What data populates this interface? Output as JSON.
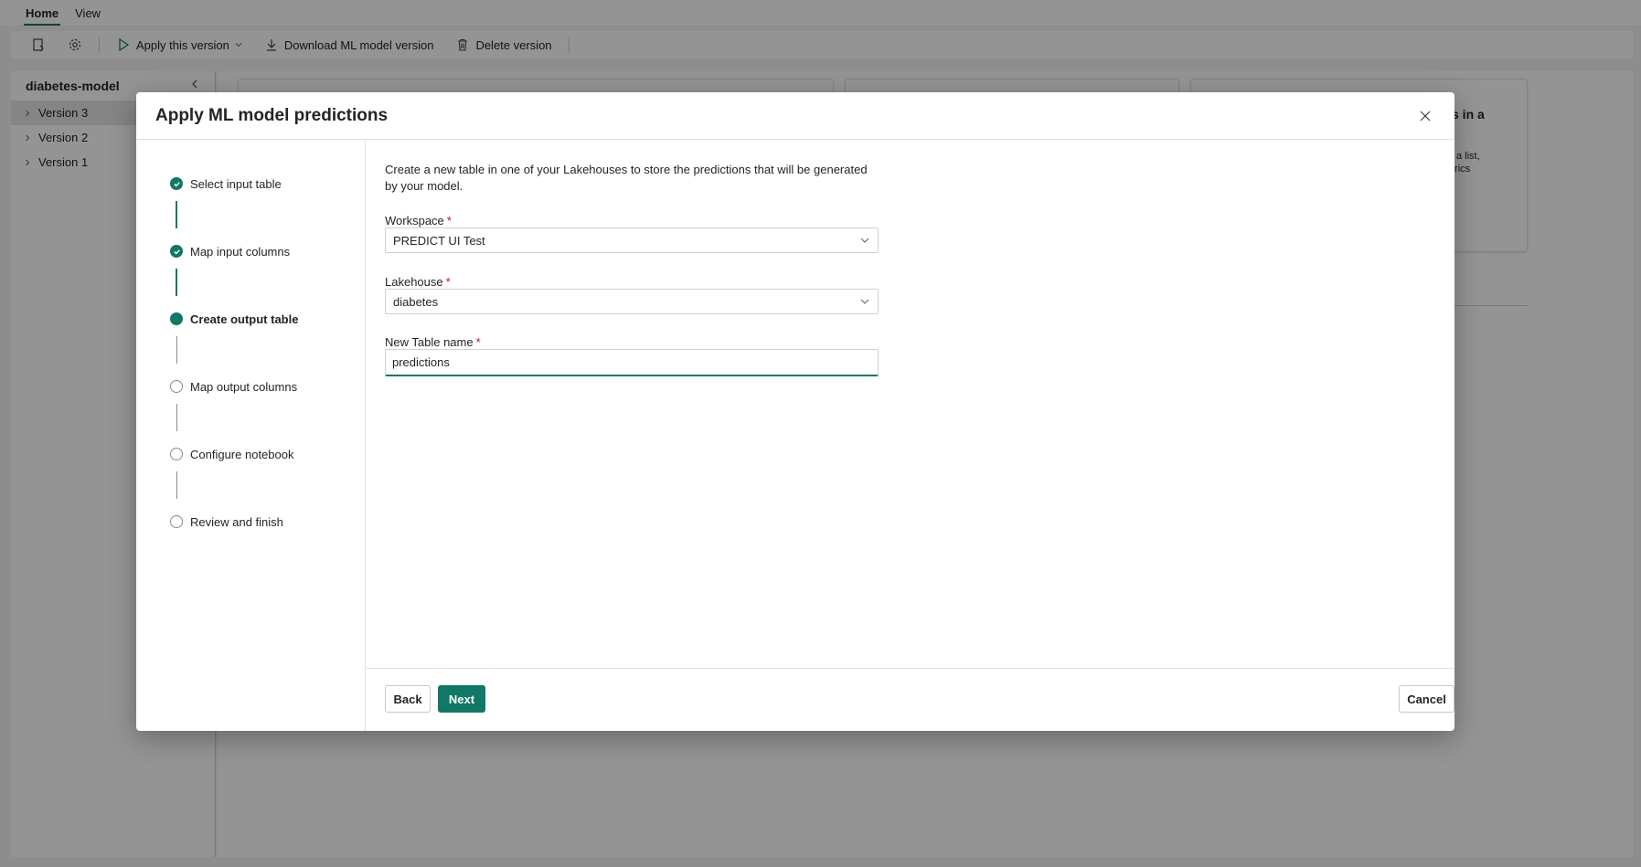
{
  "app": {
    "tabs": [
      {
        "label": "Home",
        "active": true
      },
      {
        "label": "View",
        "active": false
      }
    ],
    "toolbar": {
      "apply_label": "Apply this version",
      "download_label": "Download ML model version",
      "delete_label": "Delete version"
    },
    "sidebar": {
      "title": "diabetes-model",
      "items": [
        {
          "label": "Version 3"
        },
        {
          "label": "Version 2"
        },
        {
          "label": "Version 1"
        }
      ]
    },
    "card_fragments": {
      "title_fragment": "s in a",
      "line1": "a list,",
      "line2": "trics"
    }
  },
  "dialog": {
    "title": "Apply ML model predictions",
    "steps": [
      {
        "label": "Select input table",
        "status": "done"
      },
      {
        "label": "Map input columns",
        "status": "done"
      },
      {
        "label": "Create output table",
        "status": "current"
      },
      {
        "label": "Map output columns",
        "status": "todo"
      },
      {
        "label": "Configure notebook",
        "status": "todo"
      },
      {
        "label": "Review and finish",
        "status": "todo"
      }
    ],
    "intro": "Create a new table in one of your Lakehouses to store the predictions that will be generated by your model.",
    "workspace": {
      "label": "Workspace",
      "required_mark": "*",
      "value": "PREDICT UI Test"
    },
    "lakehouse": {
      "label": "Lakehouse",
      "required_mark": "*",
      "value": "diabetes"
    },
    "table_name": {
      "label": "New Table name",
      "required_mark": "*",
      "value": "predictions"
    },
    "buttons": {
      "back": "Back",
      "next": "Next",
      "cancel": "Cancel"
    }
  },
  "colors": {
    "accent": "#117865",
    "required": "#c50f1f"
  }
}
